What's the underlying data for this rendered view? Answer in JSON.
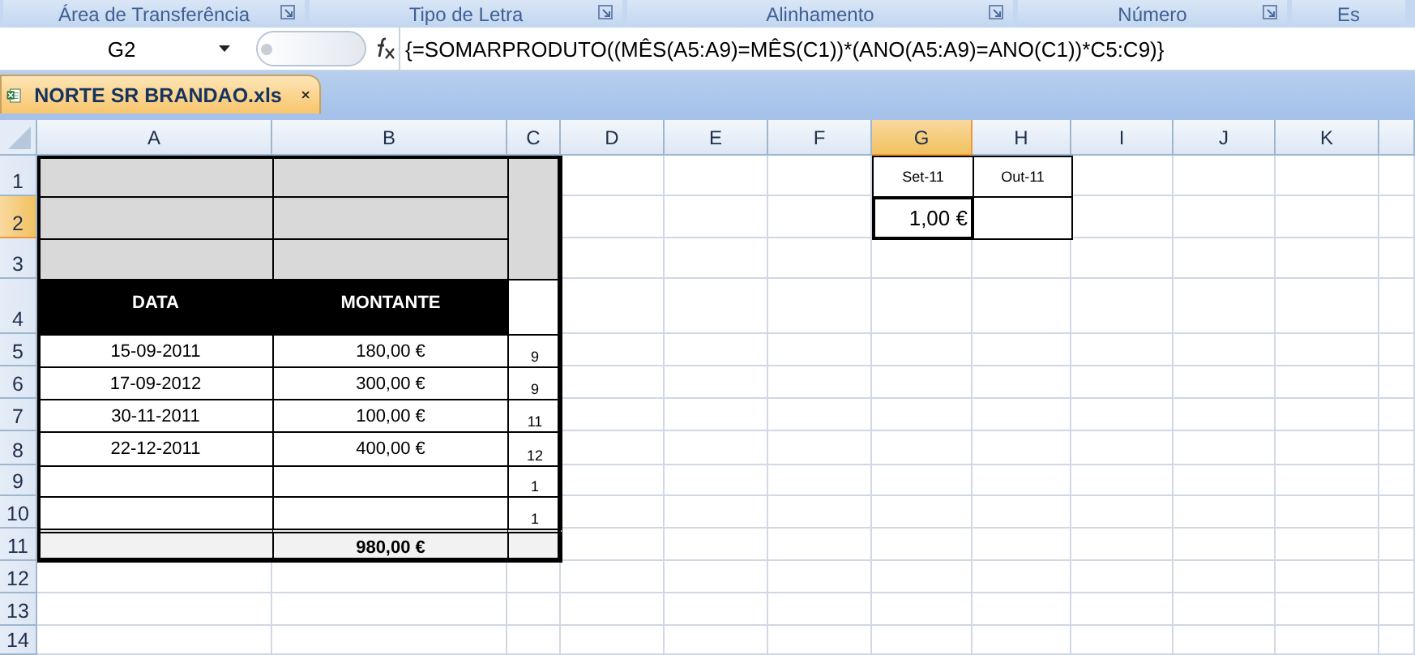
{
  "ribbon_groups": [
    {
      "label": "Área de Transferência",
      "launcher": true
    },
    {
      "label": "Tipo de Letra",
      "launcher": true
    },
    {
      "label": "Alinhamento",
      "launcher": true
    },
    {
      "label": "Número",
      "launcher": true
    },
    {
      "label": "Es",
      "launcher": false
    }
  ],
  "formula_bar": {
    "name_box": "G2",
    "formula": "{=SOMARPRODUTO((MÊS(A5:A9)=MÊS(C1))*(ANO(A5:A9)=ANO(C1))*C5:C9)}"
  },
  "workbook_tab": {
    "title": "NORTE SR BRANDAO.xls"
  },
  "columns": [
    {
      "label": "A",
      "selected": false
    },
    {
      "label": "B",
      "selected": false
    },
    {
      "label": "C",
      "selected": false
    },
    {
      "label": "D",
      "selected": false
    },
    {
      "label": "E",
      "selected": false
    },
    {
      "label": "F",
      "selected": false
    },
    {
      "label": "G",
      "selected": true
    },
    {
      "label": "H",
      "selected": false
    },
    {
      "label": "I",
      "selected": false
    },
    {
      "label": "J",
      "selected": false
    },
    {
      "label": "K",
      "selected": false
    }
  ],
  "rows": [
    {
      "label": "1",
      "selected": false
    },
    {
      "label": "2",
      "selected": true
    },
    {
      "label": "3",
      "selected": false
    },
    {
      "label": "4",
      "selected": false
    },
    {
      "label": "5",
      "selected": false
    },
    {
      "label": "6",
      "selected": false
    },
    {
      "label": "7",
      "selected": false
    },
    {
      "label": "8",
      "selected": false
    },
    {
      "label": "9",
      "selected": false
    },
    {
      "label": "10",
      "selected": false
    },
    {
      "label": "11",
      "selected": false
    },
    {
      "label": "12",
      "selected": false
    },
    {
      "label": "13",
      "selected": false
    },
    {
      "label": "14",
      "selected": false
    }
  ],
  "table": {
    "headers": [
      "DATA",
      "MONTANTE"
    ],
    "rows": [
      {
        "data": "15-09-2011",
        "montante": "180,00 €",
        "month": "9"
      },
      {
        "data": "17-09-2012",
        "montante": "300,00 €",
        "month": "9"
      },
      {
        "data": "30-11-2011",
        "montante": "100,00 €",
        "month": "11"
      },
      {
        "data": "22-12-2011",
        "montante": "400,00 €",
        "month": "12"
      },
      {
        "month": "1"
      },
      {
        "month": "1"
      }
    ],
    "total": "980,00 €"
  },
  "summary": [
    {
      "month": "Set-11",
      "value": "1,00 €",
      "selected": true
    },
    {
      "month": "Out-11",
      "selected": false
    }
  ]
}
